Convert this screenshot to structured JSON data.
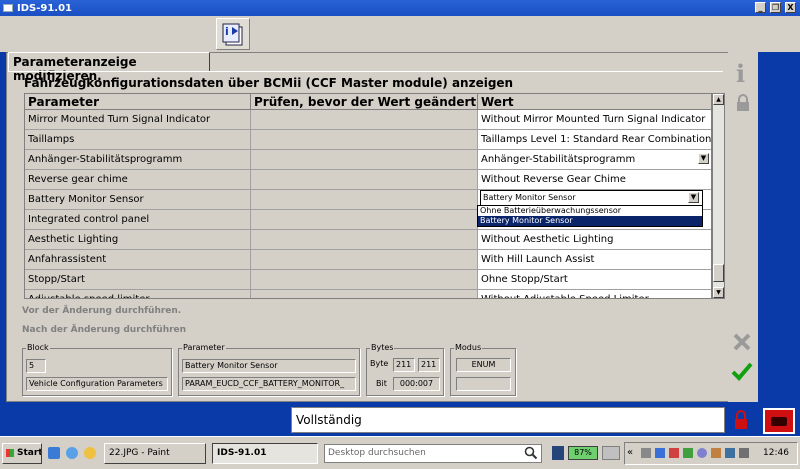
{
  "window": {
    "title": "IDS-91.01",
    "min": "_",
    "restore": "❐",
    "close": "X"
  },
  "panel": {
    "tab_label": "Parameteranzeige modifizieren.",
    "subheading": "Fahrzeugkonfigurationsdaten über BCMii (CCF Master module) anzeigen"
  },
  "table": {
    "headers": [
      "Parameter",
      "Prüfen, bevor der Wert geändert ...",
      "Wert"
    ],
    "rows": [
      {
        "param": "Mirror Mounted Turn Signal Indicator",
        "value": "Without Mirror Mounted Turn Signal Indicator"
      },
      {
        "param": "Taillamps",
        "value": "Taillamps Level 1: Standard Rear Combination ..."
      },
      {
        "param": "Anhänger-Stabilitätsprogramm",
        "value": "Anhänger-Stabilitätsprogramm"
      },
      {
        "param": "Reverse gear chime",
        "value": "Without Reverse Gear Chime"
      },
      {
        "param": "Battery Monitor Sensor",
        "value": "Battery Monitor Sensor"
      },
      {
        "param": "Integrated control panel",
        "value": ""
      },
      {
        "param": "Aesthetic Lighting",
        "value": "Without Aesthetic Lighting"
      },
      {
        "param": "Anfahrassistent",
        "value": "With Hill Launch Assist"
      },
      {
        "param": "Stopp/Start",
        "value": "Ohne Stopp/Start"
      },
      {
        "param": "Adjustable speed limiter",
        "value": "Without Adjustable Speed Limiter"
      }
    ],
    "dropdown_options": [
      "Ohne Batterieüberwachungssensor",
      "Battery Monitor Sensor"
    ]
  },
  "actions": {
    "before": "Vor der Änderung durchführen.",
    "after": "Nach der Änderung durchführen"
  },
  "info": {
    "block_label": "Block",
    "block_number": "5",
    "block_name": "Vehicle Configuration Parameters",
    "parameter_label": "Parameter",
    "parameter_name": "Battery Monitor Sensor",
    "parameter_id": "PARAM_EUCD_CCF_BATTERY_MONITOR_",
    "bytes_label": "Bytes",
    "byte_label": "Byte",
    "byte1": "211",
    "byte2": "211",
    "bit_label": "Bit",
    "bit_value": "000:007",
    "modus_label": "Modus",
    "modus_value": "ENUM",
    "modus_extra": ""
  },
  "status": {
    "text": "Vollständig"
  },
  "taskbar": {
    "start": "Start",
    "tasks": [
      "22.JPG - Paint",
      "IDS-91.01"
    ],
    "search_placeholder": "Desktop durchsuchen",
    "battery": "87%",
    "clock": "12:46",
    "tray_chevron": "«"
  },
  "colors": {
    "accent": "#0a246a",
    "titlebar": "#1a4fc3",
    "ok": "#10a010",
    "lock": "#d01010"
  }
}
